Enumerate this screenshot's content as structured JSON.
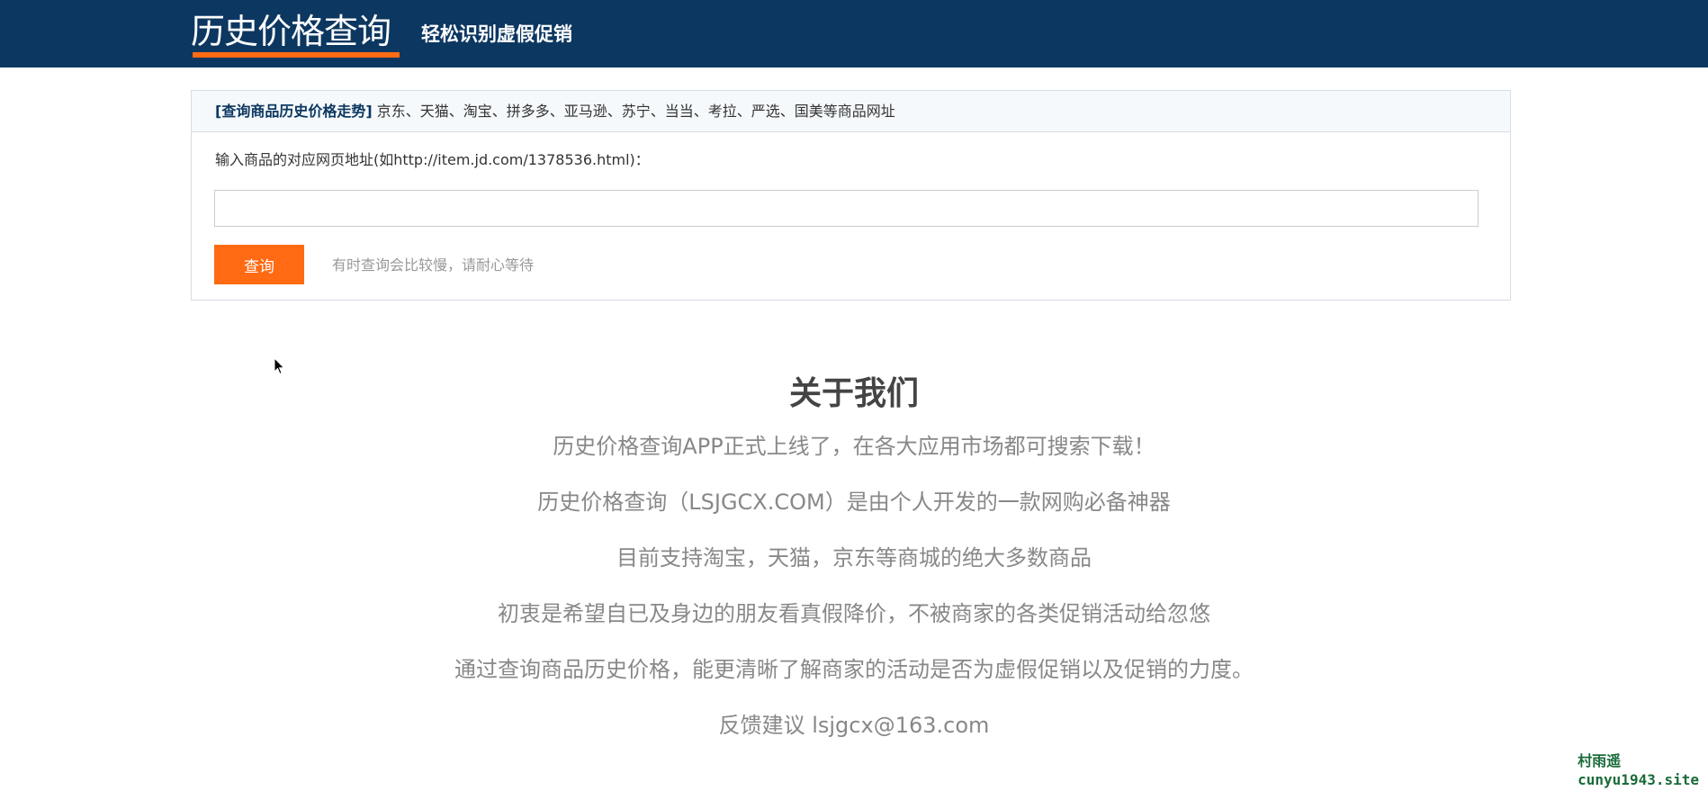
{
  "header": {
    "logo_text": "历史价格查询",
    "slogan": "轻松识别虚假促销"
  },
  "query": {
    "head_tag": "[查询商品历史价格走势]",
    "head_sites": " 京东、天猫、淘宝、拼多多、亚马逊、苏宁、当当、考拉、严选、国美等商品网址",
    "input_label": "输入商品的对应网页地址(如http://item.jd.com/1378536.html)：",
    "input_value": "",
    "input_placeholder": "",
    "button_label": "查询",
    "hint": "有时查询会比较慢，请耐心等待"
  },
  "about": {
    "title": "关于我们",
    "lines": [
      "历史价格查询APP正式上线了，在各大应用市场都可搜索下载！",
      "历史价格查询（LSJGCX.COM）是由个人开发的一款网购必备神器",
      "目前支持淘宝，天猫，京东等商城的绝大多数商品",
      "初衷是希望自已及身边的朋友看真假降价，不被商家的各类促销活动给忽悠",
      "通过查询商品历史价格，能更清晰了解商家的活动是否为虚假促销以及促销的力度。",
      "反馈建议 lsjgcx@163.com"
    ]
  },
  "watermark": {
    "line1": "村雨遥",
    "line2": "cunyu1943.site"
  },
  "colors": {
    "header_bg": "#0c3761",
    "accent": "#ff6a13"
  },
  "icons": {
    "cursor": "mouse-pointer-icon"
  }
}
